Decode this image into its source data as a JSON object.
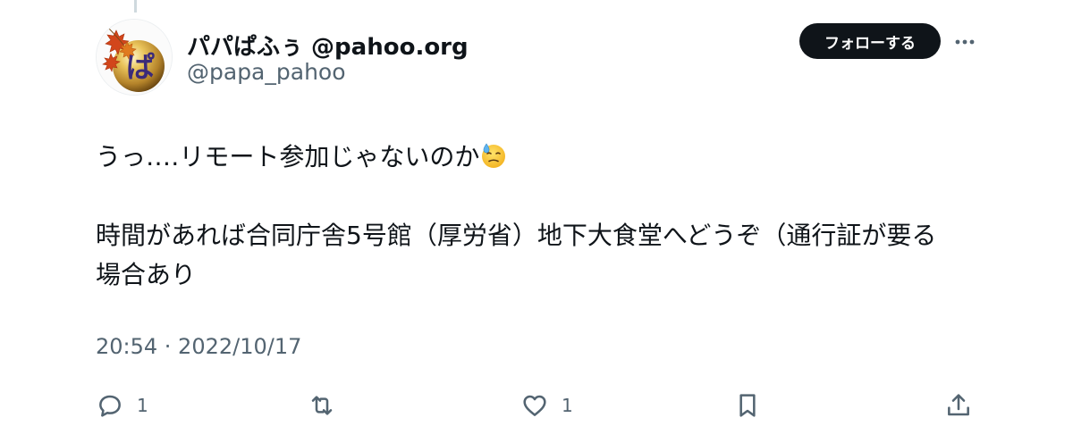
{
  "author": {
    "display_name": "パパぱふぅ @pahoo.org",
    "handle": "@papa_pahoo",
    "avatar_char": "ぱ"
  },
  "header": {
    "follow_label": "フォローする"
  },
  "tweet": {
    "line1": "うっ‥‥リモート参加じゃないのか",
    "line1_emoji": "downcast-face-with-sweat",
    "line2": "時間があれば合同庁舎5号館（厚労省）地下大食堂へどうぞ（通行証が要る",
    "line3": "場合あり",
    "timestamp": "20:54 · 2022/10/17"
  },
  "actions": {
    "reply_count": "1",
    "like_count": "1"
  },
  "colors": {
    "text": "#0f1419",
    "secondary": "#536471",
    "button_bg": "#0f1419"
  }
}
